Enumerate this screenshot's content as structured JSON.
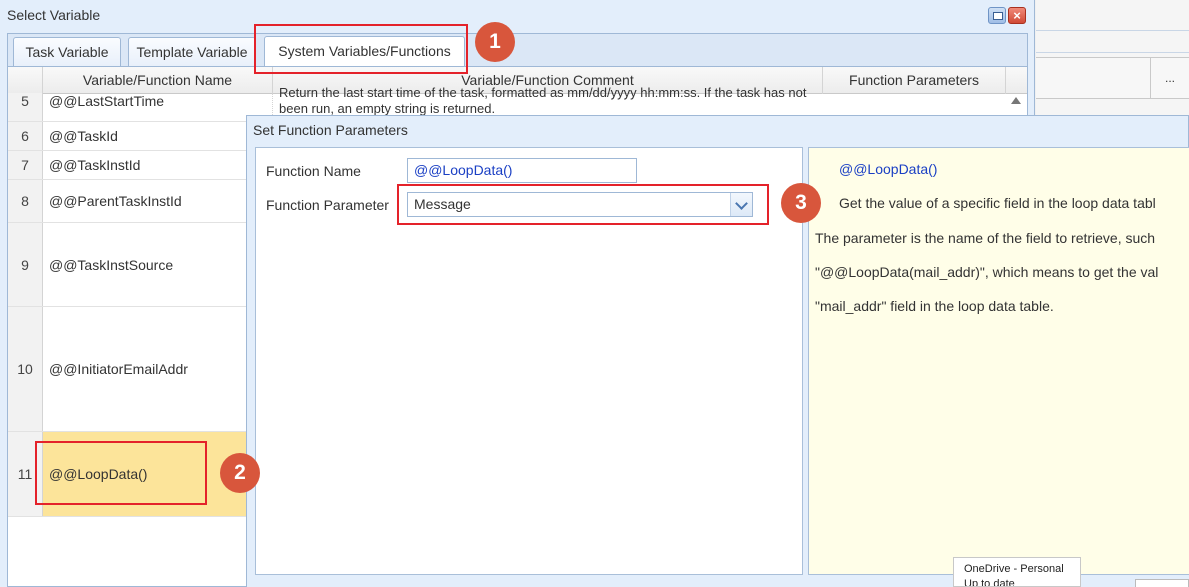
{
  "outer_dialog": {
    "title": "Select Variable",
    "close_glyph": "×"
  },
  "tabs": [
    {
      "label": "Task Variable"
    },
    {
      "label": "Template Variable"
    },
    {
      "label": "System Variables/Functions",
      "active": true
    }
  ],
  "table": {
    "headers": {
      "name": "Variable/Function Name",
      "comment": "Variable/Function Comment",
      "params": "Function Parameters"
    },
    "rows": [
      {
        "num": "5",
        "name": "@@LastStartTime",
        "comment": "Return the last start time of the task, formatted as mm/dd/yyyy hh:mm:ss. If the task has not been run, an empty string is returned."
      },
      {
        "num": "6",
        "name": "@@TaskId",
        "comment": ""
      },
      {
        "num": "7",
        "name": "@@TaskInstId",
        "comment": ""
      },
      {
        "num": "8",
        "name": "@@ParentTaskInstId",
        "comment": ""
      },
      {
        "num": "9",
        "name": "@@TaskInstSource",
        "comment": ""
      },
      {
        "num": "10",
        "name": "@@InitiatorEmailAddr",
        "comment": ""
      },
      {
        "num": "11",
        "name": "@@LoopData()",
        "comment": "",
        "selected": true
      }
    ]
  },
  "background_header": {
    "more_label": "..."
  },
  "inner_dialog": {
    "title": "Set Function Parameters",
    "function_name_label": "Function Name",
    "function_name_value": "@@LoopData()",
    "function_parameter_label": "Function Parameter",
    "function_parameter_value": "Message",
    "doc": {
      "title": "@@LoopData()",
      "line1": "Get the value of a specific field in the loop data tabl",
      "line2": "The parameter is the name of the field to retrieve, such",
      "line3": "\"@@LoopData(mail_addr)\", which means to get the val",
      "line4": "\"mail_addr\" field in the loop data table."
    }
  },
  "annotations": [
    "1",
    "2",
    "3"
  ],
  "annotation_color": "#e4222a",
  "badge_color": "#d8563c",
  "selected_row_color": "#fce49a",
  "onedrive": {
    "line1": "OneDrive - Personal",
    "line2": "Up to date"
  }
}
